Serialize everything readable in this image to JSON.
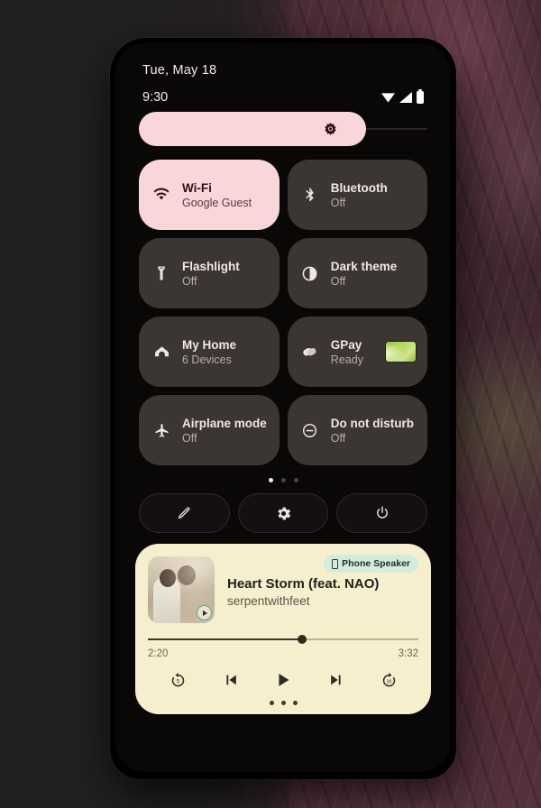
{
  "status": {
    "date": "Tue, May 18",
    "clock": "9:30",
    "icons": [
      "wifi-icon",
      "cell-signal-icon",
      "battery-icon"
    ]
  },
  "brightness": {
    "name": "brightness-slider",
    "icon": "brightness-icon",
    "value_percent": 76
  },
  "tiles": [
    {
      "label": "Wi-Fi",
      "sub": "Google Guest",
      "icon": "wifi-icon",
      "active": true,
      "name": "tile-wifi"
    },
    {
      "label": "Bluetooth",
      "sub": "Off",
      "icon": "bluetooth-icon",
      "active": false,
      "name": "tile-bluetooth"
    },
    {
      "label": "Flashlight",
      "sub": "Off",
      "icon": "flashlight-icon",
      "active": false,
      "name": "tile-flashlight"
    },
    {
      "label": "Dark theme",
      "sub": "Off",
      "icon": "dark-theme-icon",
      "active": false,
      "name": "tile-dark-theme"
    },
    {
      "label": "My Home",
      "sub": "6 Devices",
      "icon": "home-icon",
      "active": false,
      "name": "tile-my-home"
    },
    {
      "label": "GPay",
      "sub": "Ready",
      "icon": "gpay-icon",
      "active": false,
      "name": "tile-gpay",
      "card": true
    },
    {
      "label": "Airplane mode",
      "sub": "Off",
      "icon": "airplane-icon",
      "active": false,
      "name": "tile-airplane-mode"
    },
    {
      "label": "Do not disturb",
      "sub": "Off",
      "icon": "do-not-disturb-icon",
      "active": false,
      "name": "tile-do-not-disturb"
    }
  ],
  "page_indicator": {
    "count": 3,
    "active_index": 0
  },
  "actions": [
    {
      "icon": "edit-pencil-icon",
      "name": "edit-tiles-button"
    },
    {
      "icon": "gear-icon",
      "name": "settings-button"
    },
    {
      "icon": "power-icon",
      "name": "power-button"
    }
  ],
  "media": {
    "title": "Heart Storm (feat. NAO)",
    "artist": "serpentwithfeet",
    "output_chip": {
      "label": "Phone Speaker",
      "icon": "phone-icon"
    },
    "album_art": "album-art-two-people-embracing",
    "art_badge_icon": "play-badge-icon",
    "elapsed": "2:20",
    "duration": "3:32",
    "progress_percent": 57,
    "controls": [
      {
        "icon": "rewind-5-icon",
        "name": "rewind-5-button"
      },
      {
        "icon": "previous-icon",
        "name": "previous-track-button"
      },
      {
        "icon": "play-icon",
        "name": "play-button"
      },
      {
        "icon": "next-icon",
        "name": "next-track-button"
      },
      {
        "icon": "forward-30-icon",
        "name": "forward-30-button"
      }
    ],
    "dots_count": 3
  },
  "colors": {
    "accent_pink": "#f9d6da",
    "tile_bg": "#3b3533",
    "media_bg": "#f6efce",
    "chip_bg": "#d4ecdd",
    "screen_bg": "#0a0707"
  }
}
